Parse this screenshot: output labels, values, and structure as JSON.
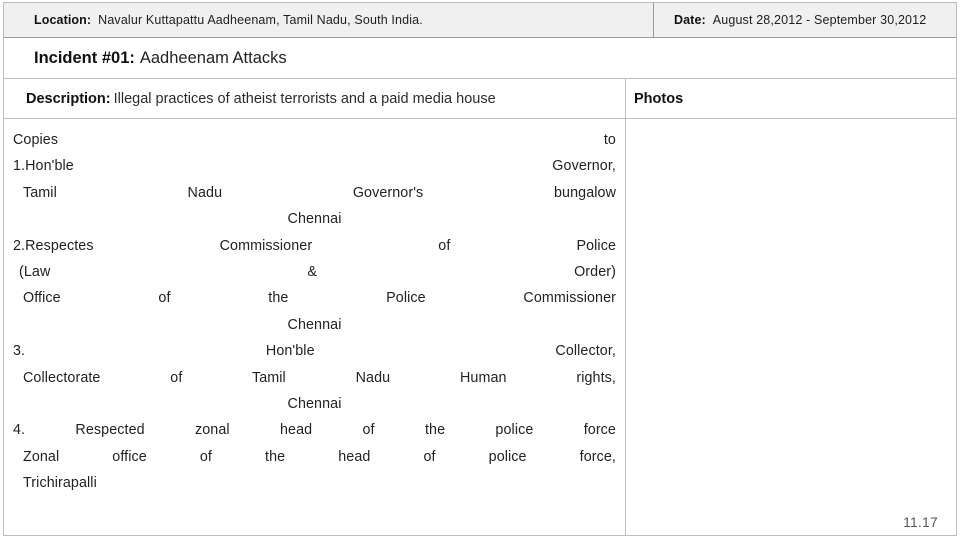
{
  "header": {
    "location_label": "Location:",
    "location_value": "Navalur Kuttapattu  Aadheenam, Tamil Nadu, South India.",
    "date_label": "Date:",
    "date_value": "August 28,2012 - September 30,2012"
  },
  "incident": {
    "label": "Incident #01:",
    "title": "Aadheenam Attacks"
  },
  "sections": {
    "description_label": "Description:",
    "description_value": "Illegal practices of atheist terrorists and a paid media house",
    "photos_label": "Photos"
  },
  "body": {
    "lead_line": "Copies to",
    "items": [
      {
        "line1": "1.Hon'ble Governor,",
        "line2": "Tamil Nadu Governor's bungalow",
        "line3": "Chennai"
      },
      {
        "line1": "2.Respectes Commissioner of Police",
        "line2": "(Law & Order)",
        "line3": "Office of the Police Commissioner",
        "line4": "Chennai"
      },
      {
        "line1": "3. Hon'ble Collector,",
        "line2": "Collectorate of Tamil Nadu Human rights,",
        "line3": "Chennai"
      },
      {
        "line1": "4. Respected zonal head of the police force",
        "line2": "Zonal office of the head of police force,",
        "line3": "Trichirapalli"
      }
    ]
  },
  "footer": {
    "page_number": "11.17"
  }
}
